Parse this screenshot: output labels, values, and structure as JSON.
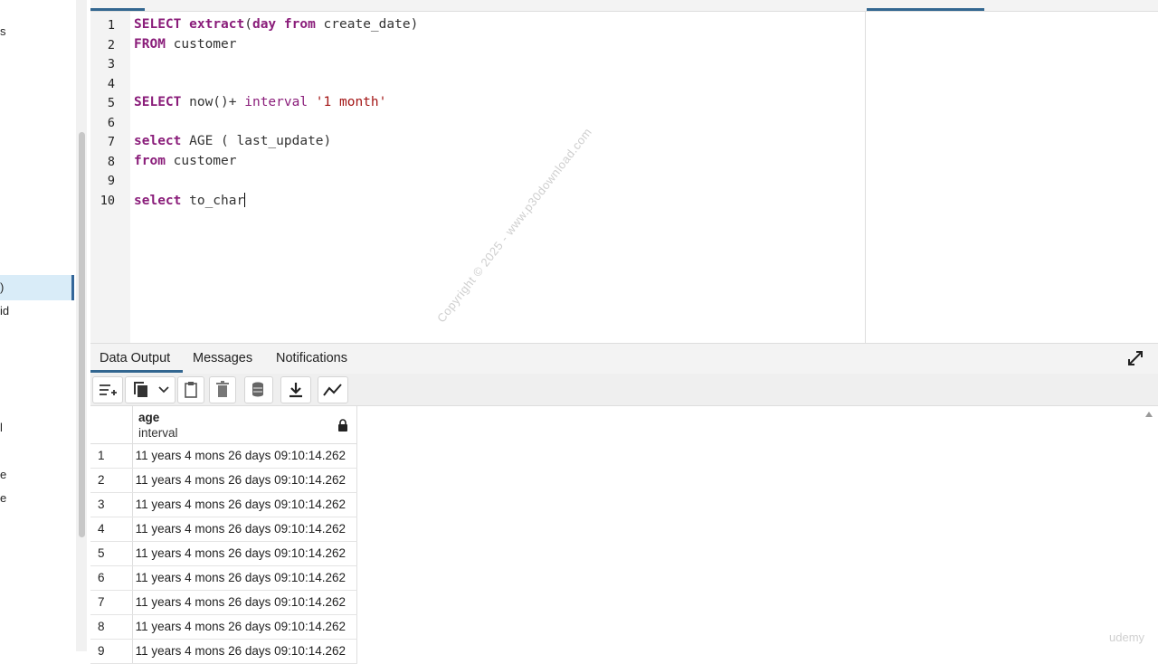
{
  "sidebar": {
    "fragments": [
      "s",
      ")",
      "id",
      "l",
      "e",
      "e"
    ]
  },
  "editor": {
    "line_numbers": [
      "1",
      "2",
      "3",
      "4",
      "5",
      "6",
      "7",
      "8",
      "9",
      "10"
    ],
    "lines": {
      "l1": {
        "k1": "SELECT",
        "k2": "extract",
        "k3": "day",
        "k4": "from",
        "rest": " create_date)"
      },
      "l2": {
        "k1": "FROM",
        "rest": " customer"
      },
      "l5": {
        "k1": "SELECT",
        "mid": " now()+ ",
        "k2": "interval",
        "str": " '1 month'"
      },
      "l7": {
        "k1": "select",
        "rest": " AGE ( last_update)"
      },
      "l8": {
        "k1": "from",
        "rest": " customer"
      },
      "l10": {
        "k1": "select",
        "rest": " to_char"
      }
    }
  },
  "watermark": "Copyright © 2025 - www.p30download.com",
  "results": {
    "tabs": [
      "Data Output",
      "Messages",
      "Notifications"
    ],
    "column": {
      "name": "age",
      "type": "interval"
    },
    "rows": [
      {
        "n": "1",
        "v": "11 years 4 mons 26 days 09:10:14.262"
      },
      {
        "n": "2",
        "v": "11 years 4 mons 26 days 09:10:14.262"
      },
      {
        "n": "3",
        "v": "11 years 4 mons 26 days 09:10:14.262"
      },
      {
        "n": "4",
        "v": "11 years 4 mons 26 days 09:10:14.262"
      },
      {
        "n": "5",
        "v": "11 years 4 mons 26 days 09:10:14.262"
      },
      {
        "n": "6",
        "v": "11 years 4 mons 26 days 09:10:14.262"
      },
      {
        "n": "7",
        "v": "11 years 4 mons 26 days 09:10:14.262"
      },
      {
        "n": "8",
        "v": "11 years 4 mons 26 days 09:10:14.262"
      },
      {
        "n": "9",
        "v": "11 years 4 mons 26 days 09:10:14.262"
      }
    ]
  },
  "brand": "udemy",
  "colors": {
    "accent": "#326690",
    "keyword": "#8a1d7a",
    "string": "#a31515",
    "selected": "#d9ecf8"
  }
}
